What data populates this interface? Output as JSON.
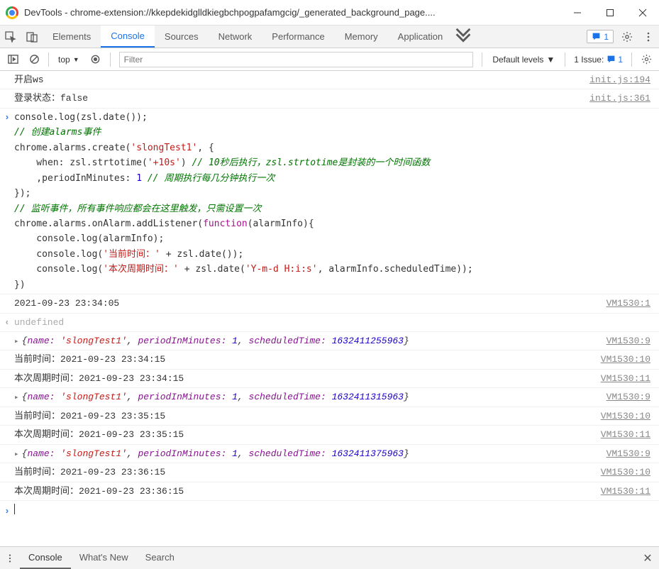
{
  "window": {
    "title": "DevTools - chrome-extension://kkepdekidglldkiegbchpogpafamgcig/_generated_background_page...."
  },
  "tabs": {
    "items": [
      "Elements",
      "Console",
      "Sources",
      "Network",
      "Performance",
      "Memory",
      "Application"
    ],
    "active": 1,
    "msg_count": "1"
  },
  "toolbar": {
    "context": "top",
    "filter_placeholder": "Filter",
    "levels": "Default levels",
    "issues_label": "1 Issue:",
    "issues_count": "1"
  },
  "logs": [
    {
      "type": "log",
      "text": "开启ws",
      "src": "init.js:194"
    },
    {
      "type": "log",
      "text": "登录状态：false",
      "src": "init.js:361"
    },
    {
      "type": "input",
      "code": [
        {
          "t": "console.log(zsl.date());",
          "cls": ""
        },
        {
          "t": "// 创建alarms事件",
          "cls": "c-com"
        },
        {
          "t": "chrome.alarms.create(",
          "cls": ""
        },
        {
          "t": "'slongTest1'",
          "cls": "c-str"
        },
        {
          "t": ", {",
          "cls": ""
        },
        {
          "t": "    when: zsl.strtotime(",
          "cls": ""
        },
        {
          "t": "'+10s'",
          "cls": "c-str"
        },
        {
          "t": ") ",
          "cls": ""
        },
        {
          "t": "// 10秒后执行，zsl.strtotime是封装的一个时间函数",
          "cls": "c-com"
        },
        {
          "t": "    ,periodInMinutes: ",
          "cls": ""
        },
        {
          "t": "1",
          "cls": "c-num"
        },
        {
          "t": " ",
          "cls": ""
        },
        {
          "t": "// 周期执行每几分钟执行一次",
          "cls": "c-com"
        },
        {
          "t": "});",
          "cls": ""
        },
        {
          "t": "// 监听事件，所有事件响应都会在这里触发，只需设置一次",
          "cls": "c-com"
        },
        {
          "t": "chrome.alarms.onAlarm.addListener(",
          "cls": ""
        },
        {
          "t": "function",
          "cls": "c-kw"
        },
        {
          "t": "(alarmInfo){",
          "cls": ""
        },
        {
          "t": "    console.log(alarmInfo);",
          "cls": ""
        },
        {
          "t": "    console.log(",
          "cls": ""
        },
        {
          "t": "'当前时间：'",
          "cls": "c-str"
        },
        {
          "t": " + zsl.date());",
          "cls": ""
        },
        {
          "t": "    console.log(",
          "cls": ""
        },
        {
          "t": "'本次周期时间：'",
          "cls": "c-str"
        },
        {
          "t": " + zsl.date(",
          "cls": ""
        },
        {
          "t": "'Y-m-d H:i:s'",
          "cls": "c-str"
        },
        {
          "t": ", alarmInfo.scheduledTime));",
          "cls": ""
        },
        {
          "t": "})",
          "cls": ""
        }
      ]
    },
    {
      "type": "log",
      "text": "2021-09-23 23:34:05",
      "src": "VM1530:1"
    },
    {
      "type": "output",
      "text": "undefined"
    },
    {
      "type": "obj",
      "name": "slongTest1",
      "period": "1",
      "sched": "1632411255963",
      "src": "VM1530:9"
    },
    {
      "type": "log",
      "text": "当前时间：2021-09-23 23:34:15",
      "src": "VM1530:10"
    },
    {
      "type": "log",
      "text": "本次周期时间：2021-09-23 23:34:15",
      "src": "VM1530:11"
    },
    {
      "type": "obj",
      "name": "slongTest1",
      "period": "1",
      "sched": "1632411315963",
      "src": "VM1530:9"
    },
    {
      "type": "log",
      "text": "当前时间：2021-09-23 23:35:15",
      "src": "VM1530:10"
    },
    {
      "type": "log",
      "text": "本次周期时间：2021-09-23 23:35:15",
      "src": "VM1530:11"
    },
    {
      "type": "obj",
      "name": "slongTest1",
      "period": "1",
      "sched": "1632411375963",
      "src": "VM1530:9"
    },
    {
      "type": "log",
      "text": "当前时间：2021-09-23 23:36:15",
      "src": "VM1530:10"
    },
    {
      "type": "log",
      "text": "本次周期时间：2021-09-23 23:36:15",
      "src": "VM1530:11"
    }
  ],
  "obj_labels": {
    "name": "name:",
    "period": "periodInMinutes:",
    "sched": "scheduledTime:"
  },
  "drawer": {
    "tabs": [
      "Console",
      "What's New",
      "Search"
    ],
    "active": 0
  }
}
